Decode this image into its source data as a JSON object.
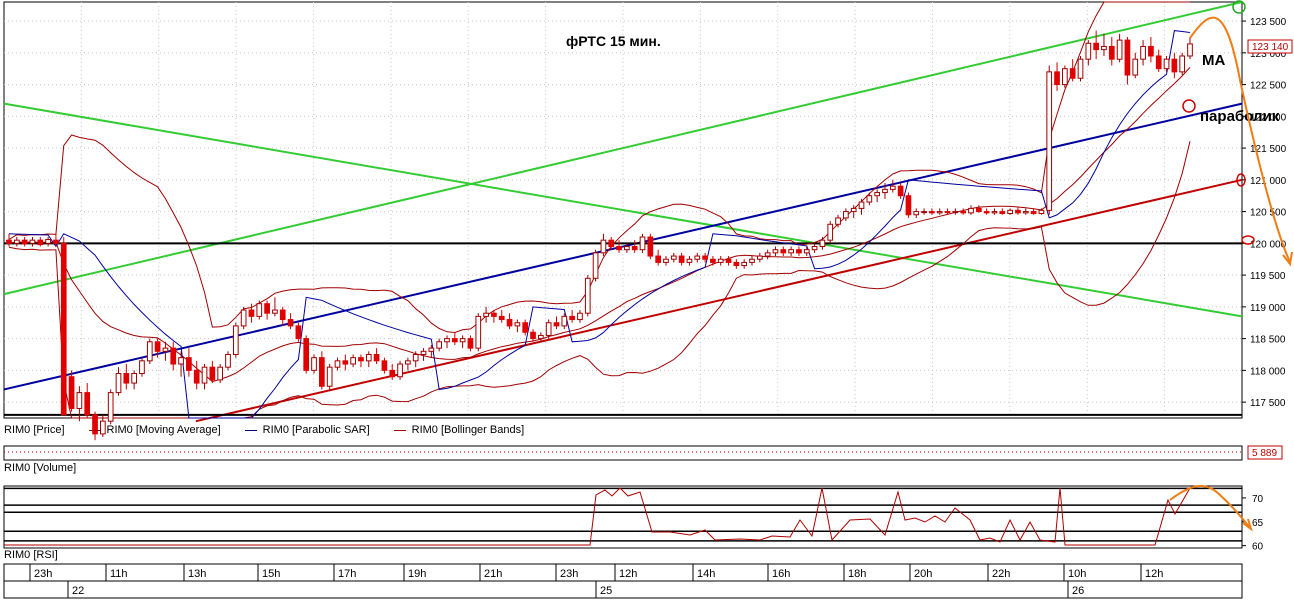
{
  "chart_data": {
    "type": "candlestick",
    "title": "фРТС   15 мин.",
    "annotations": {
      "ma": "MA",
      "parabolic": "параболик"
    },
    "price_axis": {
      "ticks": [
        117500,
        118000,
        118500,
        119000,
        119500,
        120000,
        120500,
        121000,
        121500,
        122000,
        122500,
        123000,
        123500
      ],
      "tick_labels": [
        "117 500",
        "118 000",
        "118 500",
        "119 000",
        "119 500",
        "120 000",
        "120 500",
        "121 000",
        "121 500",
        "122 000",
        "122 500",
        "123 000",
        "123 500"
      ],
      "ylim": [
        117250,
        123800
      ],
      "current_label": "123 140",
      "current_value": 123140
    },
    "volume_axis": {
      "current_label": "5 889"
    },
    "rsi_axis": {
      "ticks": [
        60,
        65,
        70
      ],
      "tick_labels": [
        "60",
        "65",
        "70"
      ],
      "ylim": [
        59.5,
        72.5
      ],
      "levels": [
        61,
        63,
        67,
        68.5,
        72
      ]
    },
    "time_axis": {
      "hour_labels": [
        "23h",
        "11h",
        "13h",
        "15h",
        "17h",
        "19h",
        "21h",
        "23h",
        "12h",
        "14h",
        "16h",
        "18h",
        "20h",
        "22h",
        "10h",
        "12h"
      ],
      "date_labels": [
        "22",
        "25",
        "26"
      ]
    },
    "legend": [
      {
        "name": "RIM0 [Price]",
        "color": "#000000"
      },
      {
        "name": "RIM0 [Moving Average]",
        "color": "#a00000"
      },
      {
        "name": "RIM0 [Parabolic SAR]",
        "color": "#000080"
      },
      {
        "name": "RIM0 [Bollinger Bands]",
        "color": "#a00000"
      }
    ],
    "panels": {
      "volume": "RIM0 [Volume]",
      "rsi": "RIM0 [RSI]"
    },
    "candles": [
      {
        "o": 120050,
        "h": 120150,
        "l": 119950,
        "c": 120000
      },
      {
        "o": 120000,
        "h": 120100,
        "l": 119950,
        "c": 120050
      },
      {
        "o": 120050,
        "h": 120100,
        "l": 119950,
        "c": 119990
      },
      {
        "o": 120000,
        "h": 120100,
        "l": 119950,
        "c": 120050
      },
      {
        "o": 120050,
        "h": 120100,
        "l": 119950,
        "c": 119980
      },
      {
        "o": 120000,
        "h": 120100,
        "l": 119950,
        "c": 120060
      },
      {
        "o": 120050,
        "h": 120150,
        "l": 119950,
        "c": 120000
      },
      {
        "o": 120000,
        "h": 120100,
        "l": 117300,
        "c": 117300
      },
      {
        "o": 117900,
        "h": 118000,
        "l": 117350,
        "c": 117400
      },
      {
        "o": 117400,
        "h": 117750,
        "l": 117200,
        "c": 117650
      },
      {
        "o": 117650,
        "h": 117800,
        "l": 117250,
        "c": 117300
      },
      {
        "o": 117300,
        "h": 117350,
        "l": 116900,
        "c": 117000
      },
      {
        "o": 117000,
        "h": 117300,
        "l": 116950,
        "c": 117200
      },
      {
        "o": 117200,
        "h": 117700,
        "l": 117150,
        "c": 117650
      },
      {
        "o": 117650,
        "h": 118050,
        "l": 117600,
        "c": 117950
      },
      {
        "o": 117950,
        "h": 118100,
        "l": 117700,
        "c": 117800
      },
      {
        "o": 117800,
        "h": 118000,
        "l": 117700,
        "c": 117950
      },
      {
        "o": 117950,
        "h": 118200,
        "l": 117900,
        "c": 118150
      },
      {
        "o": 118150,
        "h": 118500,
        "l": 118100,
        "c": 118450
      },
      {
        "o": 118450,
        "h": 118500,
        "l": 118200,
        "c": 118300
      },
      {
        "o": 118300,
        "h": 118450,
        "l": 118150,
        "c": 118350
      },
      {
        "o": 118350,
        "h": 118450,
        "l": 118000,
        "c": 118100
      },
      {
        "o": 118100,
        "h": 118300,
        "l": 117900,
        "c": 118200
      },
      {
        "o": 118200,
        "h": 118350,
        "l": 117900,
        "c": 118000
      },
      {
        "o": 118000,
        "h": 118150,
        "l": 117700,
        "c": 117800
      },
      {
        "o": 117800,
        "h": 118100,
        "l": 117700,
        "c": 118050
      },
      {
        "o": 118050,
        "h": 118150,
        "l": 117800,
        "c": 117850
      },
      {
        "o": 117850,
        "h": 118100,
        "l": 117800,
        "c": 118050
      },
      {
        "o": 118050,
        "h": 118300,
        "l": 118000,
        "c": 118250
      },
      {
        "o": 118250,
        "h": 118750,
        "l": 118200,
        "c": 118700
      },
      {
        "o": 118700,
        "h": 119000,
        "l": 118650,
        "c": 118950
      },
      {
        "o": 118950,
        "h": 119050,
        "l": 118750,
        "c": 118850
      },
      {
        "o": 118850,
        "h": 119100,
        "l": 118800,
        "c": 119050
      },
      {
        "o": 119050,
        "h": 119100,
        "l": 118800,
        "c": 118900
      },
      {
        "o": 118900,
        "h": 119150,
        "l": 118850,
        "c": 118950
      },
      {
        "o": 118950,
        "h": 119000,
        "l": 118700,
        "c": 118800
      },
      {
        "o": 118800,
        "h": 118900,
        "l": 118650,
        "c": 118700
      },
      {
        "o": 118700,
        "h": 118750,
        "l": 118450,
        "c": 118500
      },
      {
        "o": 118500,
        "h": 118550,
        "l": 117950,
        "c": 118000
      },
      {
        "o": 118000,
        "h": 118250,
        "l": 117950,
        "c": 118200
      },
      {
        "o": 118200,
        "h": 118300,
        "l": 117700,
        "c": 117750
      },
      {
        "o": 117750,
        "h": 118100,
        "l": 117700,
        "c": 118050
      },
      {
        "o": 118050,
        "h": 118200,
        "l": 118000,
        "c": 118150
      },
      {
        "o": 118150,
        "h": 118250,
        "l": 118000,
        "c": 118100
      },
      {
        "o": 118100,
        "h": 118250,
        "l": 118050,
        "c": 118200
      },
      {
        "o": 118200,
        "h": 118250,
        "l": 118050,
        "c": 118150
      },
      {
        "o": 118150,
        "h": 118300,
        "l": 118050,
        "c": 118250
      },
      {
        "o": 118250,
        "h": 118350,
        "l": 118100,
        "c": 118150
      },
      {
        "o": 118150,
        "h": 118200,
        "l": 117950,
        "c": 118000
      },
      {
        "o": 118000,
        "h": 118100,
        "l": 117850,
        "c": 117900
      },
      {
        "o": 117900,
        "h": 118150,
        "l": 117850,
        "c": 118100
      },
      {
        "o": 118100,
        "h": 118200,
        "l": 118000,
        "c": 118150
      },
      {
        "o": 118150,
        "h": 118300,
        "l": 118050,
        "c": 118250
      },
      {
        "o": 118250,
        "h": 118350,
        "l": 118150,
        "c": 118300
      },
      {
        "o": 118300,
        "h": 118400,
        "l": 118200,
        "c": 118350
      },
      {
        "o": 118350,
        "h": 118500,
        "l": 118300,
        "c": 118450
      },
      {
        "o": 118450,
        "h": 118550,
        "l": 118350,
        "c": 118500
      },
      {
        "o": 118500,
        "h": 118600,
        "l": 118400,
        "c": 118450
      },
      {
        "o": 118450,
        "h": 118550,
        "l": 118350,
        "c": 118500
      },
      {
        "o": 118500,
        "h": 118550,
        "l": 118300,
        "c": 118350
      },
      {
        "o": 118350,
        "h": 118900,
        "l": 118300,
        "c": 118850
      },
      {
        "o": 118850,
        "h": 119000,
        "l": 118750,
        "c": 118900
      },
      {
        "o": 118900,
        "h": 118950,
        "l": 118750,
        "c": 118850
      },
      {
        "o": 118850,
        "h": 118950,
        "l": 118750,
        "c": 118800
      },
      {
        "o": 118800,
        "h": 118900,
        "l": 118650,
        "c": 118700
      },
      {
        "o": 118700,
        "h": 118800,
        "l": 118600,
        "c": 118750
      },
      {
        "o": 118750,
        "h": 118800,
        "l": 118550,
        "c": 118600
      },
      {
        "o": 118600,
        "h": 118650,
        "l": 118450,
        "c": 118500
      },
      {
        "o": 118500,
        "h": 118600,
        "l": 118450,
        "c": 118550
      },
      {
        "o": 118550,
        "h": 118800,
        "l": 118500,
        "c": 118750
      },
      {
        "o": 118750,
        "h": 118850,
        "l": 118650,
        "c": 118700
      },
      {
        "o": 118700,
        "h": 118900,
        "l": 118650,
        "c": 118850
      },
      {
        "o": 118850,
        "h": 118950,
        "l": 118750,
        "c": 118800
      },
      {
        "o": 118800,
        "h": 118950,
        "l": 118750,
        "c": 118900
      },
      {
        "o": 118900,
        "h": 119500,
        "l": 118850,
        "c": 119450
      },
      {
        "o": 119450,
        "h": 119900,
        "l": 119400,
        "c": 119850
      },
      {
        "o": 119850,
        "h": 120150,
        "l": 119800,
        "c": 120050
      },
      {
        "o": 120050,
        "h": 120100,
        "l": 119900,
        "c": 119950
      },
      {
        "o": 119950,
        "h": 120050,
        "l": 119850,
        "c": 119900
      },
      {
        "o": 119900,
        "h": 120000,
        "l": 119850,
        "c": 119950
      },
      {
        "o": 119950,
        "h": 120050,
        "l": 119850,
        "c": 119900
      },
      {
        "o": 119900,
        "h": 120150,
        "l": 119850,
        "c": 120100
      },
      {
        "o": 120100,
        "h": 120150,
        "l": 119750,
        "c": 119800
      },
      {
        "o": 119800,
        "h": 119900,
        "l": 119650,
        "c": 119700
      },
      {
        "o": 119700,
        "h": 119800,
        "l": 119650,
        "c": 119750
      },
      {
        "o": 119750,
        "h": 119850,
        "l": 119700,
        "c": 119800
      },
      {
        "o": 119800,
        "h": 119850,
        "l": 119650,
        "c": 119700
      },
      {
        "o": 119700,
        "h": 119800,
        "l": 119650,
        "c": 119750
      },
      {
        "o": 119750,
        "h": 119850,
        "l": 119700,
        "c": 119800
      },
      {
        "o": 119800,
        "h": 119850,
        "l": 119700,
        "c": 119750
      },
      {
        "o": 119750,
        "h": 119800,
        "l": 119650,
        "c": 119700
      },
      {
        "o": 119700,
        "h": 119800,
        "l": 119650,
        "c": 119750
      },
      {
        "o": 119750,
        "h": 119800,
        "l": 119650,
        "c": 119700
      },
      {
        "o": 119700,
        "h": 119750,
        "l": 119600,
        "c": 119650
      },
      {
        "o": 119650,
        "h": 119750,
        "l": 119600,
        "c": 119700
      },
      {
        "o": 119700,
        "h": 119800,
        "l": 119650,
        "c": 119750
      },
      {
        "o": 119750,
        "h": 119850,
        "l": 119700,
        "c": 119800
      },
      {
        "o": 119800,
        "h": 119900,
        "l": 119750,
        "c": 119850
      },
      {
        "o": 119850,
        "h": 119950,
        "l": 119800,
        "c": 119900
      },
      {
        "o": 119900,
        "h": 119950,
        "l": 119800,
        "c": 119850
      },
      {
        "o": 119850,
        "h": 119950,
        "l": 119800,
        "c": 119900
      },
      {
        "o": 119900,
        "h": 119950,
        "l": 119800,
        "c": 119850
      },
      {
        "o": 119850,
        "h": 119950,
        "l": 119800,
        "c": 119900
      },
      {
        "o": 119900,
        "h": 120000,
        "l": 119850,
        "c": 119950
      },
      {
        "o": 119950,
        "h": 120100,
        "l": 119900,
        "c": 120050
      },
      {
        "o": 120050,
        "h": 120350,
        "l": 120000,
        "c": 120300
      },
      {
        "o": 120300,
        "h": 120450,
        "l": 120250,
        "c": 120400
      },
      {
        "o": 120400,
        "h": 120550,
        "l": 120350,
        "c": 120500
      },
      {
        "o": 120500,
        "h": 120600,
        "l": 120400,
        "c": 120550
      },
      {
        "o": 120550,
        "h": 120700,
        "l": 120450,
        "c": 120650
      },
      {
        "o": 120650,
        "h": 120800,
        "l": 120600,
        "c": 120750
      },
      {
        "o": 120750,
        "h": 120850,
        "l": 120650,
        "c": 120800
      },
      {
        "o": 120800,
        "h": 120950,
        "l": 120700,
        "c": 120850
      },
      {
        "o": 120850,
        "h": 121000,
        "l": 120800,
        "c": 120900
      },
      {
        "o": 120900,
        "h": 120950,
        "l": 120700,
        "c": 120750
      },
      {
        "o": 120750,
        "h": 120800,
        "l": 120400,
        "c": 120450
      },
      {
        "o": 120450,
        "h": 120550,
        "l": 120400,
        "c": 120500
      },
      {
        "o": 120500,
        "h": 120550,
        "l": 120450,
        "c": 120500
      },
      {
        "o": 120500,
        "h": 120550,
        "l": 120450,
        "c": 120480
      },
      {
        "o": 120480,
        "h": 120550,
        "l": 120450,
        "c": 120500
      },
      {
        "o": 120500,
        "h": 120550,
        "l": 120450,
        "c": 120490
      },
      {
        "o": 120490,
        "h": 120550,
        "l": 120450,
        "c": 120500
      },
      {
        "o": 120500,
        "h": 120550,
        "l": 120450,
        "c": 120480
      },
      {
        "o": 120480,
        "h": 120600,
        "l": 120450,
        "c": 120550
      },
      {
        "o": 120550,
        "h": 120600,
        "l": 120480,
        "c": 120500
      },
      {
        "o": 120500,
        "h": 120550,
        "l": 120450,
        "c": 120480
      },
      {
        "o": 120480,
        "h": 120550,
        "l": 120450,
        "c": 120500
      },
      {
        "o": 120500,
        "h": 120550,
        "l": 120450,
        "c": 120470
      },
      {
        "o": 120470,
        "h": 120550,
        "l": 120450,
        "c": 120520
      },
      {
        "o": 120520,
        "h": 120580,
        "l": 120450,
        "c": 120480
      },
      {
        "o": 120480,
        "h": 120550,
        "l": 120450,
        "c": 120500
      },
      {
        "o": 120500,
        "h": 120550,
        "l": 120450,
        "c": 120470
      },
      {
        "o": 120470,
        "h": 120550,
        "l": 120450,
        "c": 120520
      },
      {
        "o": 120520,
        "h": 122800,
        "l": 120450,
        "c": 122700
      },
      {
        "o": 122700,
        "h": 122850,
        "l": 122400,
        "c": 122500
      },
      {
        "o": 122500,
        "h": 122800,
        "l": 122450,
        "c": 122750
      },
      {
        "o": 122750,
        "h": 122900,
        "l": 122550,
        "c": 122600
      },
      {
        "o": 122600,
        "h": 122950,
        "l": 122550,
        "c": 122900
      },
      {
        "o": 122900,
        "h": 123200,
        "l": 122800,
        "c": 123150
      },
      {
        "o": 123150,
        "h": 123350,
        "l": 122900,
        "c": 123050
      },
      {
        "o": 123050,
        "h": 123300,
        "l": 122950,
        "c": 123100
      },
      {
        "o": 123100,
        "h": 123250,
        "l": 122800,
        "c": 122900
      },
      {
        "o": 122900,
        "h": 123300,
        "l": 122850,
        "c": 123200
      },
      {
        "o": 123200,
        "h": 123250,
        "l": 122500,
        "c": 122650
      },
      {
        "o": 122650,
        "h": 123000,
        "l": 122600,
        "c": 122900
      },
      {
        "o": 122900,
        "h": 123200,
        "l": 122800,
        "c": 123100
      },
      {
        "o": 123100,
        "h": 123250,
        "l": 122850,
        "c": 122950
      },
      {
        "o": 122950,
        "h": 123050,
        "l": 122700,
        "c": 122750
      },
      {
        "o": 122750,
        "h": 122950,
        "l": 122700,
        "c": 122900
      },
      {
        "o": 122900,
        "h": 123000,
        "l": 122600,
        "c": 122700
      },
      {
        "o": 122700,
        "h": 123000,
        "l": 122650,
        "c": 122950
      },
      {
        "o": 122950,
        "h": 123250,
        "l": 122900,
        "c": 123140
      }
    ],
    "trend_lines": [
      {
        "name": "green-upper-channel",
        "color": "#33cc33",
        "from": {
          "t": 0,
          "v": 119200
        },
        "to": {
          "t": 1,
          "v": 123800
        }
      },
      {
        "name": "green-descending",
        "color": "#33cc33",
        "from": {
          "t": 0,
          "v": 122200
        },
        "to": {
          "t": 1,
          "v": 118850
        }
      },
      {
        "name": "blue-trend",
        "color": "#0000a0",
        "from": {
          "t": 0,
          "v": 117700
        },
        "to": {
          "t": 1,
          "v": 122200
        }
      },
      {
        "name": "red-trend",
        "color": "#c00000",
        "from": {
          "t": 0.155,
          "v": 117200
        },
        "to": {
          "t": 1,
          "v": 121000
        }
      },
      {
        "name": "support-120000",
        "color": "#000000",
        "from": {
          "t": 0,
          "v": 120000
        },
        "to": {
          "t": 1,
          "v": 120000
        }
      },
      {
        "name": "support-117300",
        "color": "#000000",
        "from": {
          "t": 0,
          "v": 117300
        },
        "to": {
          "t": 1,
          "v": 117300
        }
      }
    ]
  }
}
